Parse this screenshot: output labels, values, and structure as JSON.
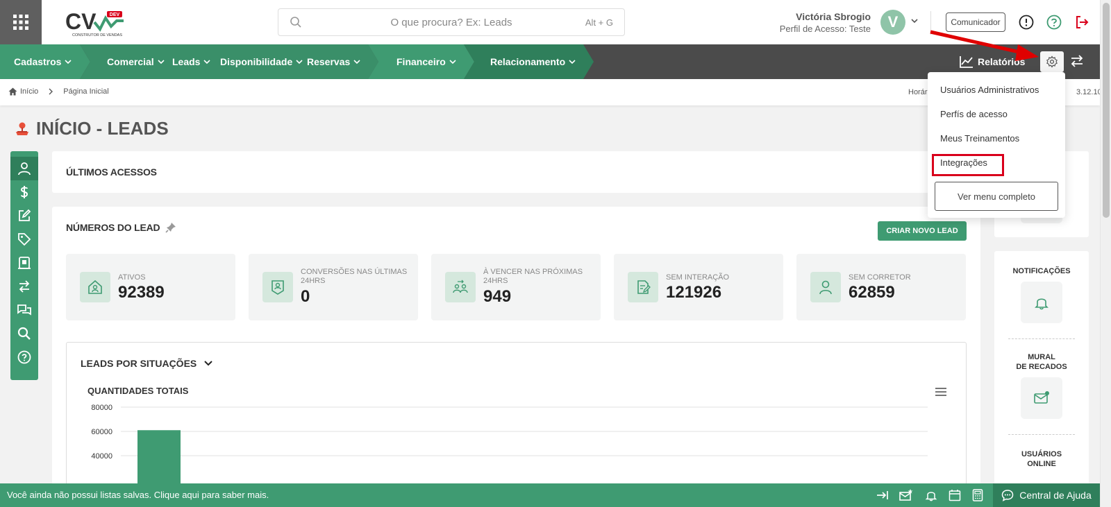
{
  "header": {
    "search_placeholder": "O que procura? Ex: Leads",
    "search_shortcut": "Alt + G",
    "user_name": "Victória Sbrogio",
    "user_profile": "Perfil de Acesso: Teste",
    "avatar_letter": "V",
    "communicator_label": "Comunicador",
    "logo_text": "CV",
    "logo_badge": "DEV",
    "logo_sub": "CONSTRUTOR DE VENDAS"
  },
  "nav": {
    "items": [
      {
        "label": "Cadastros"
      },
      {
        "label": "Comercial"
      },
      {
        "label": "Leads"
      },
      {
        "label": "Disponibilidade"
      },
      {
        "label": "Reservas"
      },
      {
        "label": "Financeiro"
      },
      {
        "label": "Relacionamento"
      }
    ],
    "reports_label": "Relatórios"
  },
  "breadcrumb": {
    "home": "Início",
    "current": "Página Inicial",
    "time_label": "Horár",
    "version": "3.12.10"
  },
  "page": {
    "title": "INÍCIO - LEADS"
  },
  "recent": {
    "title": "ÚLTIMOS ACESSOS"
  },
  "lead_numbers": {
    "title": "NÚMEROS DO LEAD",
    "new_lead_button": "CRIAR NOVO LEAD",
    "stats": [
      {
        "label": "ATIVOS",
        "value": "92389"
      },
      {
        "label": "CONVERSÕES NAS ÚLTIMAS 24hrs",
        "value": "0"
      },
      {
        "label": "À VENCER NAS PRÓXIMAS 24hrs",
        "value": "949"
      },
      {
        "label": "SEM INTERAÇÃO",
        "value": "121926"
      },
      {
        "label": "SEM CORRETOR",
        "value": "62859"
      }
    ]
  },
  "situations": {
    "title": "LEADS POR SITUAÇÕES",
    "subtitle": "QUANTIDADES TOTAIS"
  },
  "chart_data": {
    "type": "bar",
    "title": "QUANTIDADES TOTAIS",
    "y_ticks": [
      "80000",
      "60000",
      "40000"
    ],
    "ylim": [
      0,
      80000
    ],
    "values": [
      61000
    ],
    "color": "#3f9b72"
  },
  "right_panel": {
    "notifications_label": "NOTIFICAÇÕES",
    "mural_label_1": "MURAL",
    "mural_label_2": "DE RECADOS",
    "online_label_1": "USUÁRIOS",
    "online_label_2": "ONLINE"
  },
  "dropdown": {
    "items": [
      {
        "label": "Usuários Administrativos"
      },
      {
        "label": "Perfís de acesso"
      },
      {
        "label": "Meus Treinamentos"
      },
      {
        "label": "Integrações"
      }
    ],
    "full_menu_button": "Ver menu completo"
  },
  "footer": {
    "message": "Você ainda não possui listas salvas. Clique aqui para saber mais.",
    "help_label": "Central de Ajuda"
  },
  "colors": {
    "primary_green": "#3f9b72",
    "dark_green": "#2f7f5b",
    "nav_gray": "#4b4b4b",
    "highlight_red": "#d9001b"
  }
}
